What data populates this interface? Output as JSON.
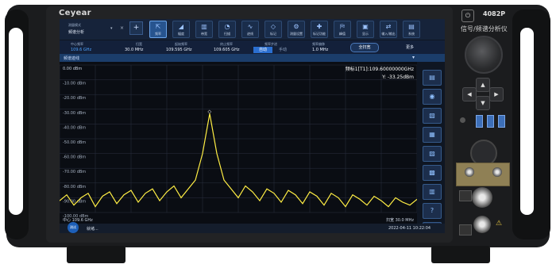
{
  "device": {
    "brand": "Ceyear",
    "model": "4082P",
    "name": "信号/频谱分析仪"
  },
  "mode": {
    "label": "测量模式",
    "value": "频谱分析"
  },
  "toolbar": [
    {
      "label": "频率",
      "icon": "frequency-icon",
      "selected": true
    },
    {
      "label": "幅度",
      "icon": "amplitude-icon"
    },
    {
      "label": "带宽",
      "icon": "bandwidth-icon"
    },
    {
      "label": "扫描",
      "icon": "sweep-icon"
    },
    {
      "label": "迹线",
      "icon": "trace-icon"
    },
    {
      "label": "标记",
      "icon": "marker-icon"
    },
    {
      "label": "测量设置",
      "icon": "meas-setup-icon"
    },
    {
      "label": "标记功能",
      "icon": "marker-func-icon"
    },
    {
      "label": "峰值",
      "icon": "peak-icon"
    },
    {
      "label": "显示",
      "icon": "display-icon"
    },
    {
      "label": "输入/输出",
      "icon": "io-icon"
    },
    {
      "label": "系统",
      "icon": "system-icon"
    }
  ],
  "params": {
    "center_label": "中心频率",
    "center_value": "109.6 GHz",
    "span_label": "扫宽",
    "span_value": "30.0 MHz",
    "start_label": "起始频率",
    "start_value": "109.595 GHz",
    "stop_label": "终止频率",
    "stop_value": "109.605 GHz",
    "cf_step_label": "频率步进",
    "auto_label": "自动",
    "manual_label": "手动",
    "step_label": "频率偏移",
    "step_value": "1.0 MHz",
    "full_span_label": "全扫宽",
    "more_label": "更多"
  },
  "trace_label": "频谱迹线",
  "graph": {
    "ref_level": "0.00 dBm",
    "y_labels": [
      "-10.00 dBm",
      "-20.00 dBm",
      "-30.00 dBm",
      "-40.00 dBm",
      "-50.00 dBm",
      "-60.00 dBm",
      "-70.00 dBm",
      "-80.00 dBm",
      "-90.00 dBm",
      "-100.00 dBm"
    ],
    "marker_line1": "频标1[T1]:109.60000000GHz",
    "marker_line2": "Y: -33.25dBm",
    "start_freq": "中心 109.6 GHz",
    "span": "扫宽 30.0 MHz",
    "marker_symbol": "◇"
  },
  "status": {
    "message": "就绪...",
    "datetime": "2022-04-11 10:22:04",
    "home_label": "测试"
  },
  "sidebar_icons": [
    "save-icon",
    "settings-icon",
    "trace-math-icon",
    "file-icon",
    "window-icon",
    "print-icon",
    "marker-list-icon",
    "help-icon",
    "fullscreen-icon"
  ],
  "colors": {
    "trace": "#ffee44",
    "accent": "#4ea3ff",
    "background": "#0a0d13"
  },
  "chart_data": {
    "type": "line",
    "title": "",
    "xlabel": "",
    "ylabel": "",
    "x_start_mhz": 109595,
    "x_stop_mhz": 109605,
    "ylim": [
      -100,
      0
    ],
    "y_unit": "dBm",
    "series": [
      {
        "x": [
          0,
          2,
          4,
          6,
          8,
          10,
          12,
          14,
          16,
          18,
          20,
          22,
          24,
          26,
          28,
          30,
          32,
          34,
          36,
          38,
          40,
          42,
          44,
          46,
          48,
          50,
          52,
          54,
          56,
          58,
          60,
          62,
          64,
          66,
          68,
          70,
          72,
          74,
          76,
          78,
          80,
          82,
          84,
          86,
          88,
          90,
          92,
          94,
          96,
          98,
          100
        ],
        "y": [
          -92,
          -88,
          -95,
          -90,
          -87,
          -96,
          -89,
          -86,
          -94,
          -88,
          -85,
          -93,
          -87,
          -84,
          -92,
          -86,
          -82,
          -90,
          -84,
          -78,
          -60,
          -33,
          -60,
          -78,
          -84,
          -90,
          -82,
          -86,
          -92,
          -84,
          -87,
          -93,
          -85,
          -88,
          -94,
          -86,
          -89,
          -95,
          -87,
          -90,
          -96,
          -88,
          -91,
          -95,
          -89,
          -92,
          -96,
          -90,
          -93,
          -95,
          -91
        ]
      }
    ]
  }
}
